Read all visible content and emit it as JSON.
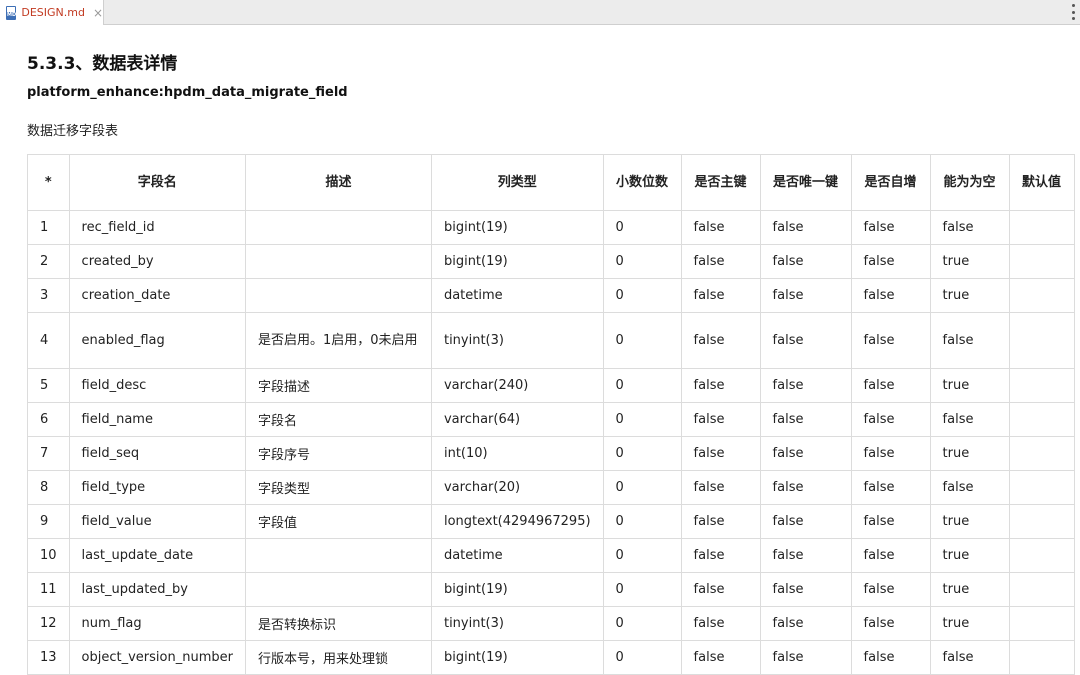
{
  "tab": {
    "filename": "DESIGN.md",
    "icon": "markdown-file-icon",
    "close": "×"
  },
  "doc": {
    "section_title": "5.3.3、数据表详情",
    "table_name": "platform_enhance:hpdm_data_migrate_field",
    "table_desc": "数据迁移字段表"
  },
  "table": {
    "headers": [
      "*",
      "字段名",
      "描述",
      "列类型",
      "小数位数",
      "是否主键",
      "是否唯一键",
      "是否自增",
      "能为为空",
      "默认值"
    ],
    "rows": [
      [
        "1",
        "rec_field_id",
        "",
        "bigint(19)",
        "0",
        "false",
        "false",
        "false",
        "false",
        ""
      ],
      [
        "2",
        "created_by",
        "",
        "bigint(19)",
        "0",
        "false",
        "false",
        "false",
        "true",
        ""
      ],
      [
        "3",
        "creation_date",
        "",
        "datetime",
        "0",
        "false",
        "false",
        "false",
        "true",
        ""
      ],
      [
        "4",
        "enabled_flag",
        "是否启用。1启用，0未启用",
        "tinyint(3)",
        "0",
        "false",
        "false",
        "false",
        "false",
        ""
      ],
      [
        "5",
        "field_desc",
        "字段描述",
        "varchar(240)",
        "0",
        "false",
        "false",
        "false",
        "true",
        ""
      ],
      [
        "6",
        "field_name",
        "字段名",
        "varchar(64)",
        "0",
        "false",
        "false",
        "false",
        "false",
        ""
      ],
      [
        "7",
        "field_seq",
        "字段序号",
        "int(10)",
        "0",
        "false",
        "false",
        "false",
        "true",
        ""
      ],
      [
        "8",
        "field_type",
        "字段类型",
        "varchar(20)",
        "0",
        "false",
        "false",
        "false",
        "false",
        ""
      ],
      [
        "9",
        "field_value",
        "字段值",
        "longtext(4294967295)",
        "0",
        "false",
        "false",
        "false",
        "true",
        ""
      ],
      [
        "10",
        "last_update_date",
        "",
        "datetime",
        "0",
        "false",
        "false",
        "false",
        "true",
        ""
      ],
      [
        "11",
        "last_updated_by",
        "",
        "bigint(19)",
        "0",
        "false",
        "false",
        "false",
        "true",
        ""
      ],
      [
        "12",
        "num_flag",
        "是否转换标识",
        "tinyint(3)",
        "0",
        "false",
        "false",
        "false",
        "true",
        ""
      ],
      [
        "13",
        "object_version_number",
        "行版本号，用来处理锁",
        "bigint(19)",
        "0",
        "false",
        "false",
        "false",
        "false",
        ""
      ]
    ]
  }
}
